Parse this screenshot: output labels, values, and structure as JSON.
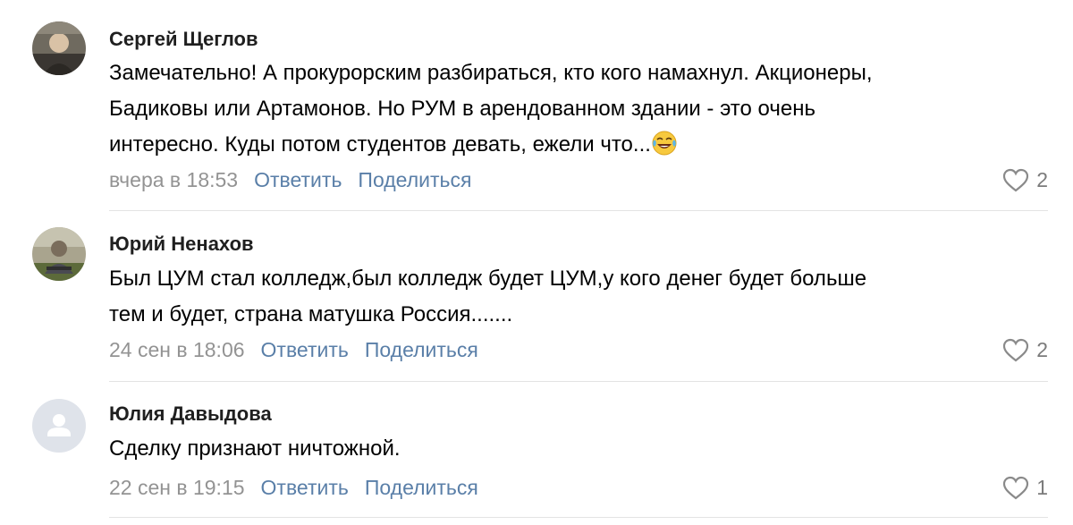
{
  "comments": [
    {
      "author": "Сергей Щеглов",
      "lines": [
        "Замечательно! А прокурорским разбираться, кто кого намахнул. Акционеры,",
        "Бадиковы или Артамонов. Но РУМ в арендованном здании - это очень",
        "интересно. Куды потом студентов девать, ежели что..."
      ],
      "emoji_icon": "face-with-tears-of-joy-icon",
      "date": "вчера в 18:53",
      "reply_label": "Ответить",
      "share_label": "Поделиться",
      "likes": "2"
    },
    {
      "author": "Юрий Ненахов",
      "lines": [
        "Был ЦУМ стал колледж,был колледж будет ЦУМ,у кого денег будет больше",
        "тем и будет, страна матушка Россия......."
      ],
      "date": "24 сен в 18:06",
      "reply_label": "Ответить",
      "share_label": "Поделиться",
      "likes": "2"
    },
    {
      "author": "Юлия Давыдова",
      "lines": [
        "Сделку признают ничтожной."
      ],
      "date": "22 сен в 19:15",
      "reply_label": "Ответить",
      "share_label": "Поделиться",
      "likes": "1"
    }
  ],
  "colors": {
    "action_link": "#5a7fa8",
    "meta_gray": "#939393",
    "divider": "#e3e3e3"
  }
}
